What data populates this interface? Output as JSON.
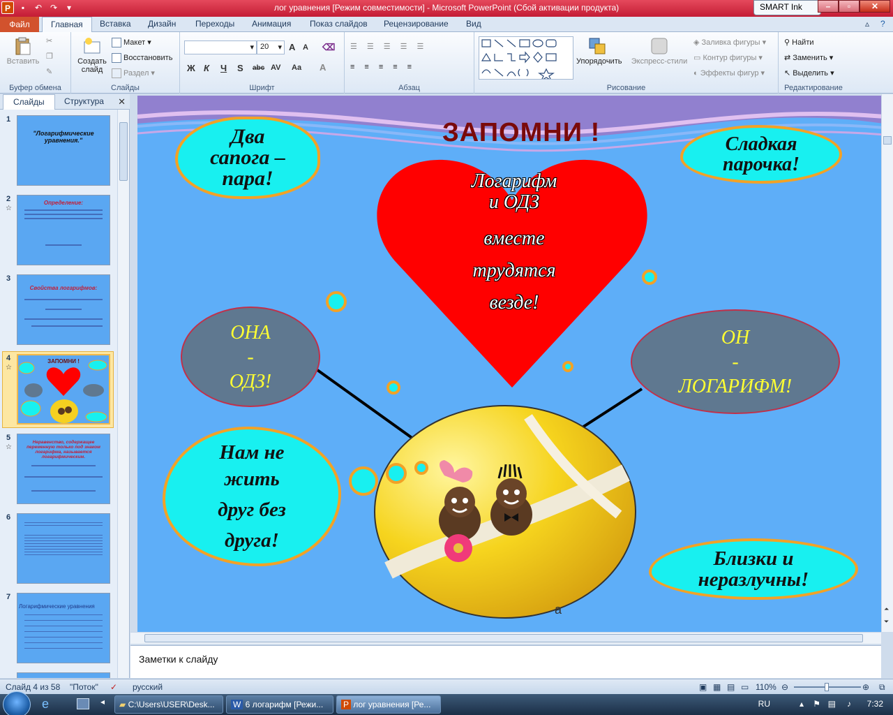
{
  "window": {
    "title": "лог уравнения [Режим совместимости]  -  Microsoft PowerPoint (Сбой активации продукта)",
    "smart_ink": "SMART Ink"
  },
  "ribbon_tabs": [
    "Файл",
    "Главная",
    "Вставка",
    "Дизайн",
    "Переходы",
    "Анимация",
    "Показ слайдов",
    "Рецензирование",
    "Вид"
  ],
  "ribbon": {
    "clipboard": {
      "paste": "Вставить",
      "label": "Буфер обмена"
    },
    "slides": {
      "create": "Создать",
      "create2": "слайд",
      "layout": "Макет",
      "reset": "Восстановить",
      "section": "Раздел",
      "label": "Слайды"
    },
    "font": {
      "size": "20",
      "label": "Шрифт",
      "bold": "Ж",
      "italic": "К",
      "underline": "Ч",
      "shadow": "S",
      "strike": "abc",
      "spacing": "AV",
      "case": "Aa",
      "color": "A",
      "grow": "A",
      "shrink": "A"
    },
    "paragraph": {
      "label": "Абзац"
    },
    "drawing": {
      "arrange": "Упорядочить",
      "quick_styles": "Экспресс-стили",
      "fill": "Заливка фигуры",
      "outline": "Контур фигуры",
      "effects": "Эффекты фигур",
      "label": "Рисование"
    },
    "editing": {
      "find": "Найти",
      "replace": "Заменить",
      "select": "Выделить",
      "label": "Редактирование"
    }
  },
  "pane": {
    "tab_slides": "Слайды",
    "tab_outline": "Структура",
    "close": "✕",
    "thumbnails": [
      {
        "num": "1",
        "title": "\"Логарифмические уравнения.\""
      },
      {
        "num": "2",
        "title": "Определение:"
      },
      {
        "num": "3",
        "title": "Свойства логарифмов:"
      },
      {
        "num": "4",
        "title": "ЗАПОМНИ !"
      },
      {
        "num": "5",
        "title": "Неравенство, содержащее переменную только под знаком логарифма, называется логарифмическим."
      },
      {
        "num": "6",
        "title": ""
      },
      {
        "num": "7",
        "title": "Логарифмические уравнения"
      }
    ]
  },
  "slide": {
    "heading": "ЗАПОМНИ !",
    "heart_lines": [
      "Логарифм",
      "и ОДЗ",
      "вместе",
      "трудятся",
      "везде!"
    ],
    "cloud_top_left": [
      "Два",
      "сапога –",
      "пара!"
    ],
    "cloud_top_right": [
      "Сладкая",
      "парочка!"
    ],
    "oval_left": [
      "ОНА",
      "-",
      "ОДЗ!"
    ],
    "oval_right": [
      "ОН",
      "-",
      "ЛОГАРИФМ!"
    ],
    "cloud_bottom_left": [
      "Нам не",
      "жить",
      "друг без",
      "друга!"
    ],
    "cloud_bottom_right": [
      "Близки и",
      "неразлучны!"
    ],
    "hidden_caption": "а"
  },
  "notes": {
    "placeholder": "Заметки к слайду"
  },
  "status": {
    "slide": "Слайд 4 из 58",
    "theme": "\"Поток\"",
    "language": "русский",
    "zoom": "110%"
  },
  "taskbar": {
    "items": [
      "C:\\Users\\USER\\Desk...",
      "6 логарифм [Режи...",
      "лог уравнения [Ре..."
    ],
    "lang": "RU",
    "time": "7:32"
  }
}
